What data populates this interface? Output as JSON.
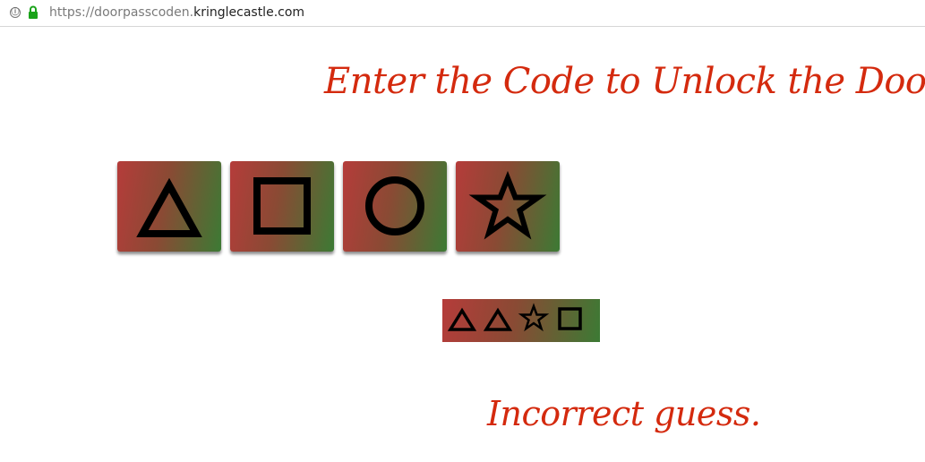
{
  "browser": {
    "url_prefix": "https://doorpasscoden.",
    "url_domain": "kringlecastle.com",
    "info_icon": "ⓘ"
  },
  "page": {
    "title": "Enter the Code to Unlock the Door",
    "message": "Incorrect guess."
  },
  "buttons": [
    {
      "symbol": "triangle-icon"
    },
    {
      "symbol": "square-icon"
    },
    {
      "symbol": "circle-icon"
    },
    {
      "symbol": "star-icon"
    }
  ],
  "guess_sequence": [
    "triangle",
    "triangle",
    "star",
    "square"
  ],
  "colors": {
    "title_red": "#d42a0e",
    "gradient_red": "#b53c3a",
    "gradient_green": "#3c7a34"
  }
}
